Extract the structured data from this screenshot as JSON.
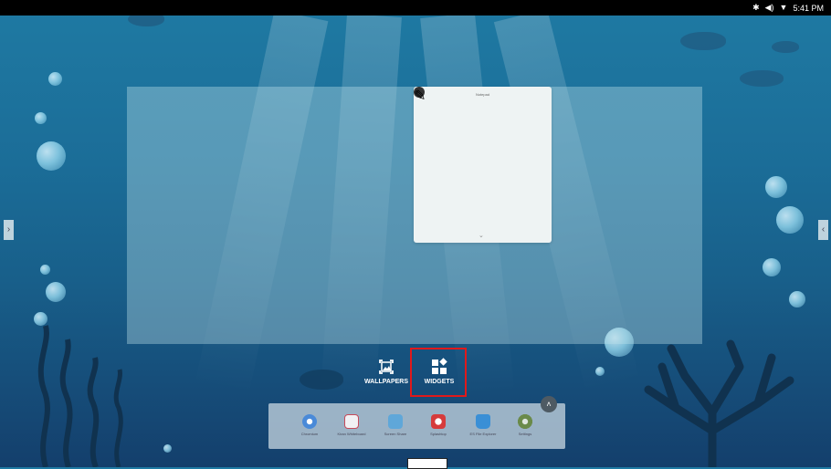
{
  "status_bar": {
    "icons": [
      "bluetooth-icon",
      "volume-icon",
      "wifi-icon"
    ],
    "time": "5:41 PM"
  },
  "widget_preview": {
    "title": "Notepad"
  },
  "options": {
    "wallpapers_label": "WALLPAPERS",
    "widgets_label": "WIDGETS"
  },
  "dock": {
    "apps": [
      {
        "name": "Chromium",
        "icon": "chromium-icon",
        "color": "#4a8ad8"
      },
      {
        "name": "Kiran Whiteboard",
        "icon": "whiteboard-icon",
        "color": "#c74a5a"
      },
      {
        "name": "Screen Share",
        "icon": "screen-share-icon",
        "color": "#5fa7d9"
      },
      {
        "name": "Splashtop",
        "icon": "splashtop-icon",
        "color": "#d63b3b"
      },
      {
        "name": "ES File Explorer",
        "icon": "folder-icon",
        "color": "#3a8fd6"
      },
      {
        "name": "Settings",
        "icon": "settings-icon",
        "color": "#6a8a4a"
      }
    ]
  },
  "colors": {
    "highlight": "#e0191b",
    "status_bar": "#000000"
  }
}
